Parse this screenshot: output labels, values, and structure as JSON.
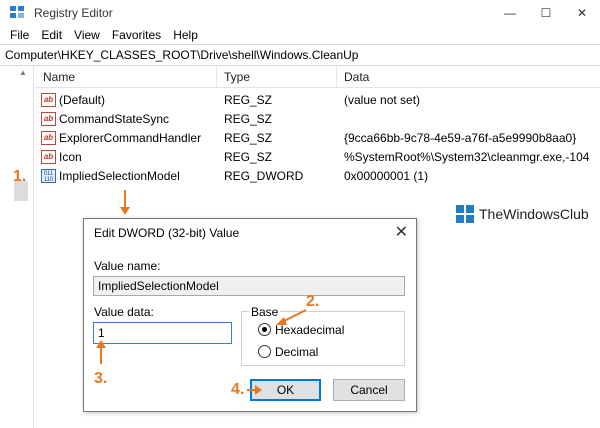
{
  "window": {
    "title": "Registry Editor",
    "controls": [
      "—",
      "☐",
      "✕"
    ]
  },
  "menu": [
    "File",
    "Edit",
    "View",
    "Favorites",
    "Help"
  ],
  "address": "Computer\\HKEY_CLASSES_ROOT\\Drive\\shell\\Windows.CleanUp",
  "columns": {
    "name": "Name",
    "type": "Type",
    "data": "Data"
  },
  "rows": [
    {
      "icon": "ab",
      "name": "(Default)",
      "type": "REG_SZ",
      "data": "(value not set)"
    },
    {
      "icon": "ab",
      "name": "CommandStateSync",
      "type": "REG_SZ",
      "data": ""
    },
    {
      "icon": "ab",
      "name": "ExplorerCommandHandler",
      "type": "REG_SZ",
      "data": "{9cca66bb-9c78-4e59-a76f-a5e9990b8aa0}"
    },
    {
      "icon": "ab",
      "name": "Icon",
      "type": "REG_SZ",
      "data": "%SystemRoot%\\System32\\cleanmgr.exe,-104"
    },
    {
      "icon": "bin",
      "name": "ImpliedSelectionModel",
      "type": "REG_DWORD",
      "data": "0x00000001 (1)"
    }
  ],
  "annotations": {
    "a1": "1.",
    "a2": "2.",
    "a3": "3.",
    "a4": "4.",
    "color": "#e87722"
  },
  "watermark": "TheWindowsClub",
  "dialog": {
    "title": "Edit DWORD (32-bit) Value",
    "close": "✕",
    "value_name_label": "Value name:",
    "value_name": "ImpliedSelectionModel",
    "value_data_label": "Value data:",
    "value_data": "1",
    "base_label": "Base",
    "radio_hex": "Hexadecimal",
    "radio_dec": "Decimal",
    "selected_base": "Hexadecimal",
    "ok": "OK",
    "cancel": "Cancel"
  },
  "colors": {
    "accent": "#0078d7",
    "string_icon": "#c0392b",
    "dword_icon": "#2b6cb0"
  }
}
